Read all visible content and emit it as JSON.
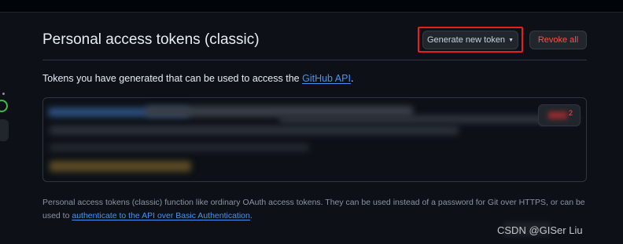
{
  "header": {
    "title": "Personal access tokens (classic)",
    "generate_label": "Generate new token",
    "revoke_label": "Revoke all"
  },
  "intro": {
    "text": "Tokens you have generated that can be used to access the ",
    "link": "GitHub API",
    "end": "."
  },
  "token_list": {
    "delete_mark": "2"
  },
  "footer": {
    "text_before": "Personal access tokens (classic) function like ordinary OAuth access tokens. They can be used instead of a password for Git over HTTPS, or can be used to ",
    "link": "authenticate to the API over Basic Authentication",
    "text_after": "."
  },
  "watermark": "CSDN @GISer Liu",
  "colors": {
    "background": "#0d1117",
    "danger": "#f85149",
    "link": "#4493f8",
    "highlight_box": "#e5201d"
  }
}
